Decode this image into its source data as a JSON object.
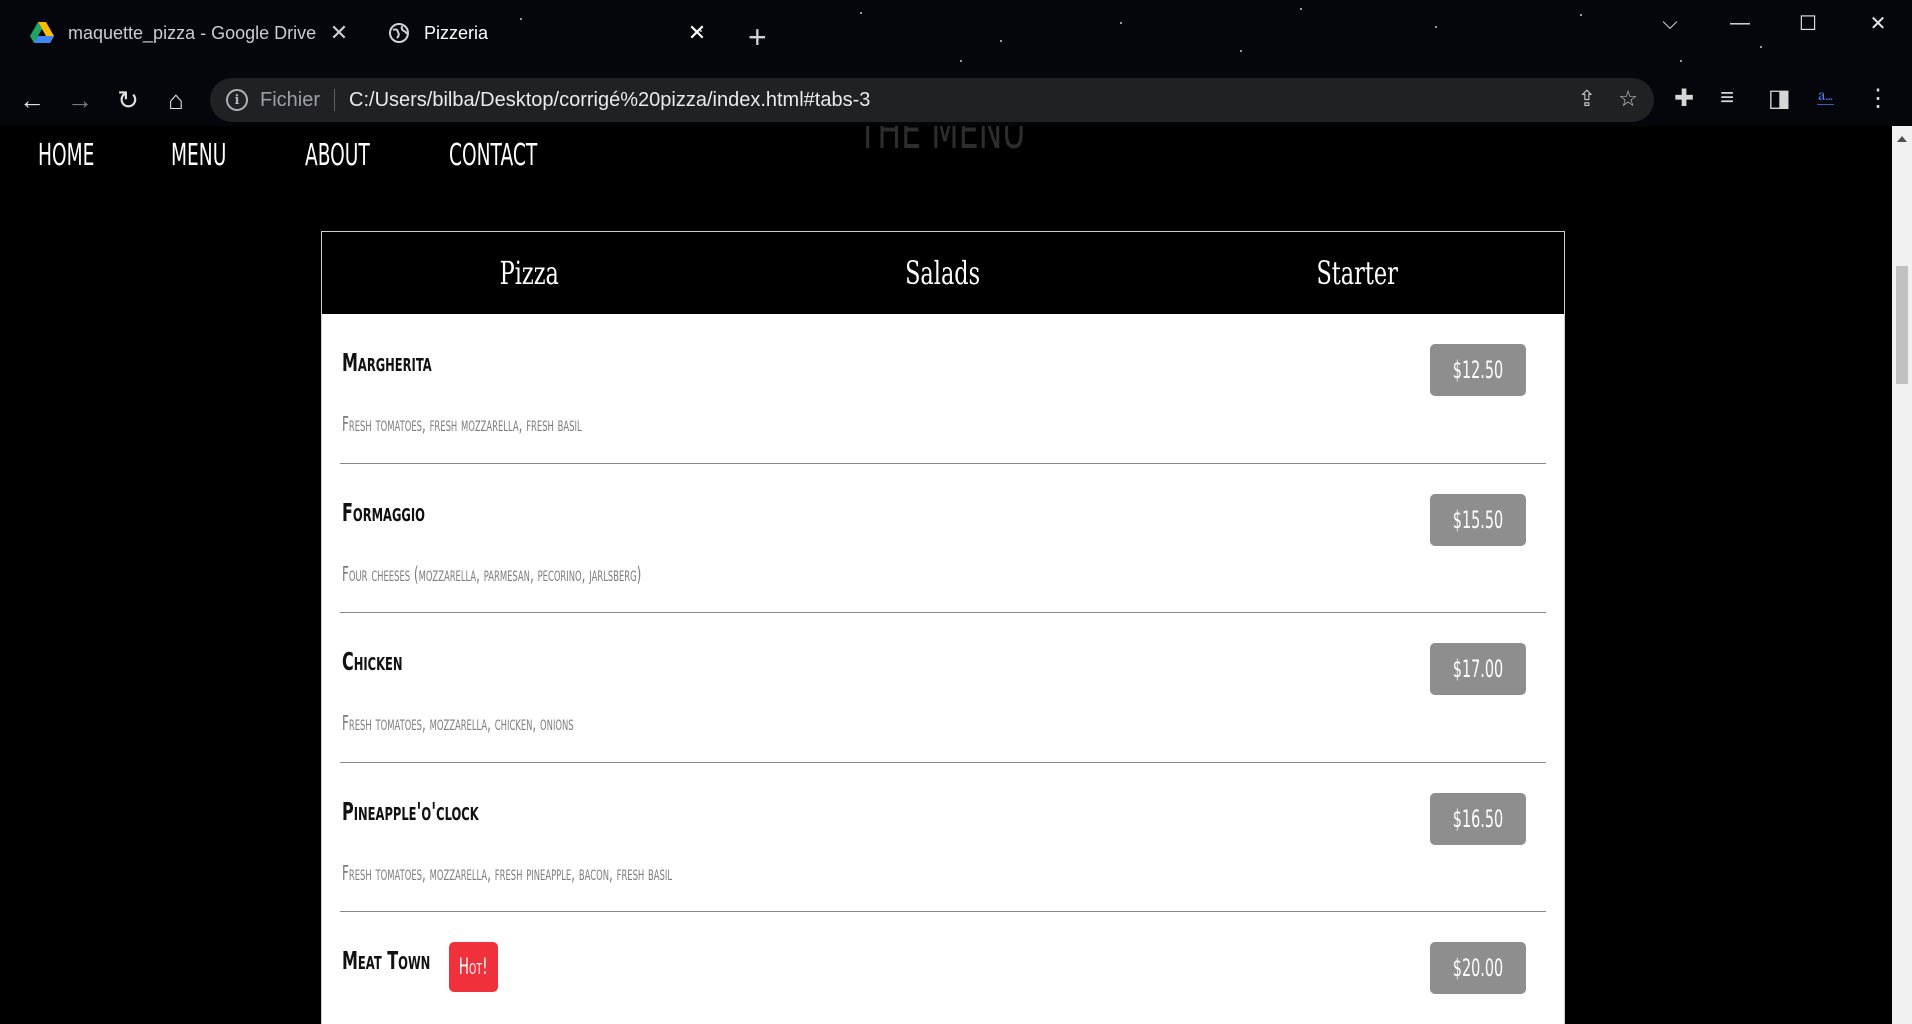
{
  "browser": {
    "tabs": [
      {
        "title": "maquette_pizza - Google Drive",
        "icon": "google-drive-icon"
      },
      {
        "title": "Pizzeria",
        "icon": "globe-icon"
      }
    ],
    "new_tab": "+",
    "omnibox": {
      "scheme_label": "Fichier",
      "url": "C:/Users/bilba/Desktop/corrigé%20pizza/index.html#tabs-3"
    }
  },
  "site": {
    "nav": [
      "HOME",
      "MENU",
      "ABOUT",
      "CONTACT"
    ],
    "section_title": "THE MENU",
    "menu_tabs": [
      "Pizza",
      "Salads",
      "Starter"
    ],
    "active_tab": "Pizza",
    "items": [
      {
        "name": "Margherita",
        "desc": "Fresh tomatoes, fresh mozzarella, fresh basil",
        "price": "$12.50",
        "hot": ""
      },
      {
        "name": "Formaggio",
        "desc": "Four cheeses (mozzarella, parmesan, pecorino, jarlsberg)",
        "price": "$15.50",
        "hot": ""
      },
      {
        "name": "Chicken",
        "desc": "Fresh tomatoes, mozzarella, chicken, onions",
        "price": "$17.00",
        "hot": ""
      },
      {
        "name": "Pineapple'o'clock",
        "desc": "Fresh tomatoes, mozzarella, fresh pineapple, bacon, fresh basil",
        "price": "$16.50",
        "hot": ""
      },
      {
        "name": "Meat Town",
        "desc": "",
        "price": "$20.00",
        "hot": "Hot!"
      }
    ]
  },
  "colors": {
    "page_bg": "#000000",
    "price_badge": "#8e8e8e",
    "hot_badge": "#f0303b",
    "omnibox_bg": "#202124"
  }
}
